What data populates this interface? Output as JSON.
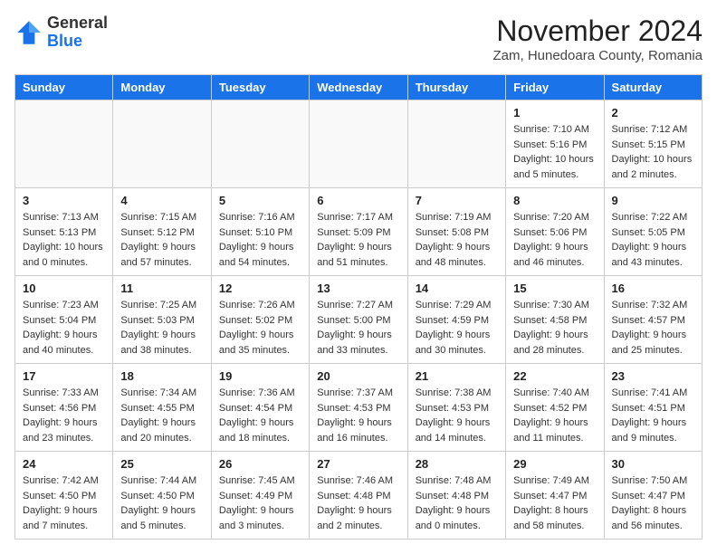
{
  "header": {
    "logo_general": "General",
    "logo_blue": "Blue",
    "month_title": "November 2024",
    "location": "Zam, Hunedoara County, Romania"
  },
  "weekdays": [
    "Sunday",
    "Monday",
    "Tuesday",
    "Wednesday",
    "Thursday",
    "Friday",
    "Saturday"
  ],
  "weeks": [
    [
      {
        "day": "",
        "info": ""
      },
      {
        "day": "",
        "info": ""
      },
      {
        "day": "",
        "info": ""
      },
      {
        "day": "",
        "info": ""
      },
      {
        "day": "",
        "info": ""
      },
      {
        "day": "1",
        "info": "Sunrise: 7:10 AM\nSunset: 5:16 PM\nDaylight: 10 hours\nand 5 minutes."
      },
      {
        "day": "2",
        "info": "Sunrise: 7:12 AM\nSunset: 5:15 PM\nDaylight: 10 hours\nand 2 minutes."
      }
    ],
    [
      {
        "day": "3",
        "info": "Sunrise: 7:13 AM\nSunset: 5:13 PM\nDaylight: 10 hours\nand 0 minutes."
      },
      {
        "day": "4",
        "info": "Sunrise: 7:15 AM\nSunset: 5:12 PM\nDaylight: 9 hours\nand 57 minutes."
      },
      {
        "day": "5",
        "info": "Sunrise: 7:16 AM\nSunset: 5:10 PM\nDaylight: 9 hours\nand 54 minutes."
      },
      {
        "day": "6",
        "info": "Sunrise: 7:17 AM\nSunset: 5:09 PM\nDaylight: 9 hours\nand 51 minutes."
      },
      {
        "day": "7",
        "info": "Sunrise: 7:19 AM\nSunset: 5:08 PM\nDaylight: 9 hours\nand 48 minutes."
      },
      {
        "day": "8",
        "info": "Sunrise: 7:20 AM\nSunset: 5:06 PM\nDaylight: 9 hours\nand 46 minutes."
      },
      {
        "day": "9",
        "info": "Sunrise: 7:22 AM\nSunset: 5:05 PM\nDaylight: 9 hours\nand 43 minutes."
      }
    ],
    [
      {
        "day": "10",
        "info": "Sunrise: 7:23 AM\nSunset: 5:04 PM\nDaylight: 9 hours\nand 40 minutes."
      },
      {
        "day": "11",
        "info": "Sunrise: 7:25 AM\nSunset: 5:03 PM\nDaylight: 9 hours\nand 38 minutes."
      },
      {
        "day": "12",
        "info": "Sunrise: 7:26 AM\nSunset: 5:02 PM\nDaylight: 9 hours\nand 35 minutes."
      },
      {
        "day": "13",
        "info": "Sunrise: 7:27 AM\nSunset: 5:00 PM\nDaylight: 9 hours\nand 33 minutes."
      },
      {
        "day": "14",
        "info": "Sunrise: 7:29 AM\nSunset: 4:59 PM\nDaylight: 9 hours\nand 30 minutes."
      },
      {
        "day": "15",
        "info": "Sunrise: 7:30 AM\nSunset: 4:58 PM\nDaylight: 9 hours\nand 28 minutes."
      },
      {
        "day": "16",
        "info": "Sunrise: 7:32 AM\nSunset: 4:57 PM\nDaylight: 9 hours\nand 25 minutes."
      }
    ],
    [
      {
        "day": "17",
        "info": "Sunrise: 7:33 AM\nSunset: 4:56 PM\nDaylight: 9 hours\nand 23 minutes."
      },
      {
        "day": "18",
        "info": "Sunrise: 7:34 AM\nSunset: 4:55 PM\nDaylight: 9 hours\nand 20 minutes."
      },
      {
        "day": "19",
        "info": "Sunrise: 7:36 AM\nSunset: 4:54 PM\nDaylight: 9 hours\nand 18 minutes."
      },
      {
        "day": "20",
        "info": "Sunrise: 7:37 AM\nSunset: 4:53 PM\nDaylight: 9 hours\nand 16 minutes."
      },
      {
        "day": "21",
        "info": "Sunrise: 7:38 AM\nSunset: 4:53 PM\nDaylight: 9 hours\nand 14 minutes."
      },
      {
        "day": "22",
        "info": "Sunrise: 7:40 AM\nSunset: 4:52 PM\nDaylight: 9 hours\nand 11 minutes."
      },
      {
        "day": "23",
        "info": "Sunrise: 7:41 AM\nSunset: 4:51 PM\nDaylight: 9 hours\nand 9 minutes."
      }
    ],
    [
      {
        "day": "24",
        "info": "Sunrise: 7:42 AM\nSunset: 4:50 PM\nDaylight: 9 hours\nand 7 minutes."
      },
      {
        "day": "25",
        "info": "Sunrise: 7:44 AM\nSunset: 4:50 PM\nDaylight: 9 hours\nand 5 minutes."
      },
      {
        "day": "26",
        "info": "Sunrise: 7:45 AM\nSunset: 4:49 PM\nDaylight: 9 hours\nand 3 minutes."
      },
      {
        "day": "27",
        "info": "Sunrise: 7:46 AM\nSunset: 4:48 PM\nDaylight: 9 hours\nand 2 minutes."
      },
      {
        "day": "28",
        "info": "Sunrise: 7:48 AM\nSunset: 4:48 PM\nDaylight: 9 hours\nand 0 minutes."
      },
      {
        "day": "29",
        "info": "Sunrise: 7:49 AM\nSunset: 4:47 PM\nDaylight: 8 hours\nand 58 minutes."
      },
      {
        "day": "30",
        "info": "Sunrise: 7:50 AM\nSunset: 4:47 PM\nDaylight: 8 hours\nand 56 minutes."
      }
    ]
  ]
}
